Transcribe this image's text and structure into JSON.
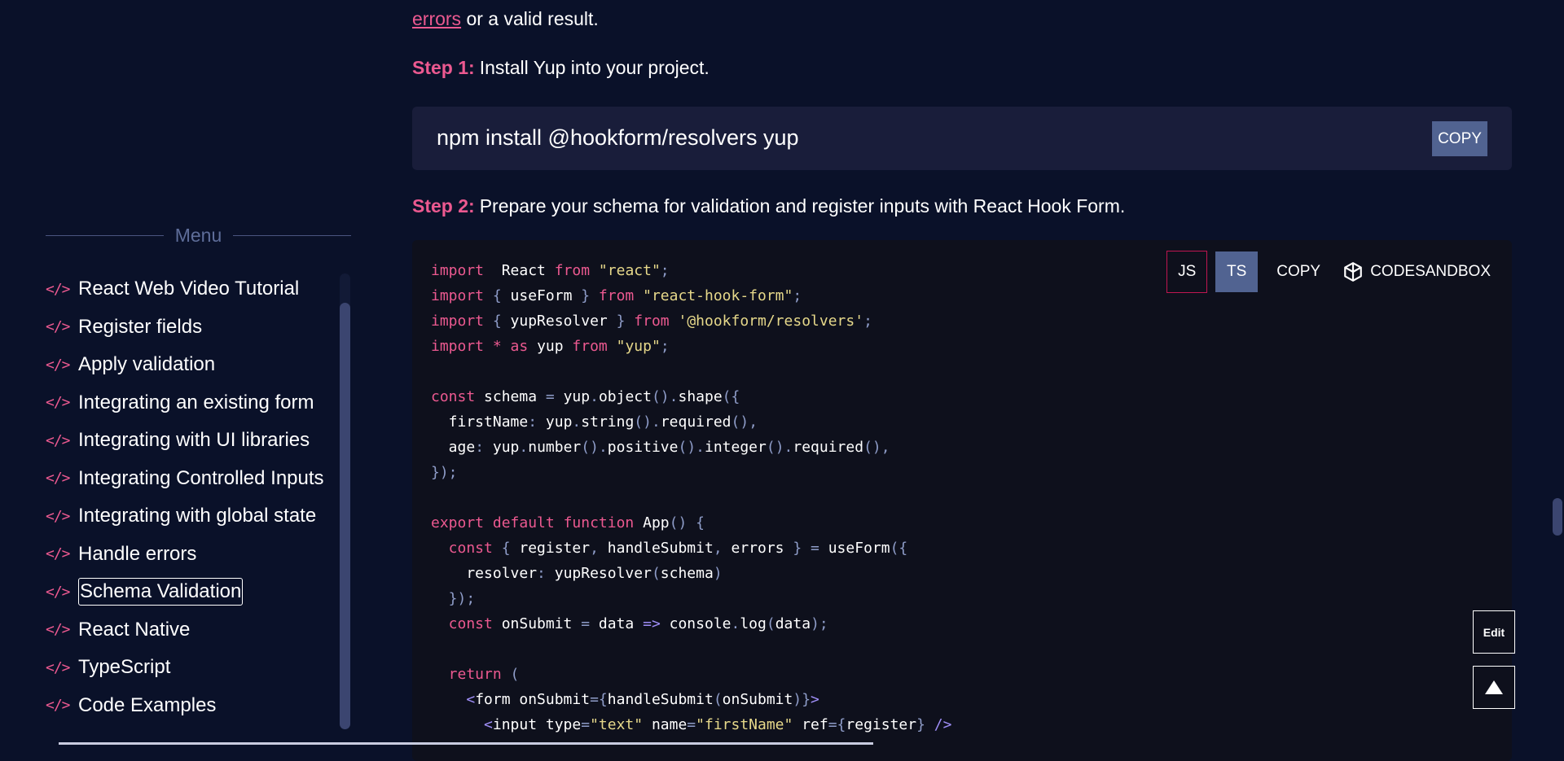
{
  "intro": {
    "link_text": "errors",
    "text_after": " or a valid result."
  },
  "step1": {
    "label": "Step 1:",
    "text": "Install Yup into your project."
  },
  "install": {
    "command": "npm install @hookform/resolvers yup",
    "copy_label": "COPY"
  },
  "step2": {
    "label": "Step 2:",
    "text": "Prepare your schema for validation and register inputs with React Hook Form."
  },
  "code_tools": {
    "js_label": "JS",
    "ts_label": "TS",
    "copy_label": "COPY",
    "sandbox_label": "CODESANDBOX",
    "sandbox_icon": "cube-icon"
  },
  "sidebar": {
    "menu_title": "Menu",
    "item_icon": "</>",
    "items": [
      {
        "label": "React Web Video Tutorial"
      },
      {
        "label": "Register fields"
      },
      {
        "label": "Apply validation"
      },
      {
        "label": "Integrating an existing form"
      },
      {
        "label": "Integrating with UI libraries"
      },
      {
        "label": "Integrating Controlled Inputs"
      },
      {
        "label": "Integrating with global state"
      },
      {
        "label": "Handle errors"
      },
      {
        "label": "Schema Validation"
      },
      {
        "label": "React Native"
      },
      {
        "label": "TypeScript"
      },
      {
        "label": "Code Examples"
      }
    ],
    "active_index": 8
  },
  "code_lines": [
    [
      [
        "kw",
        "import"
      ],
      [
        "",
        "  React "
      ],
      [
        "kw",
        "from"
      ],
      [
        "",
        ""
      ],
      [
        "str",
        " \"react\""
      ],
      [
        "pu",
        ";"
      ]
    ],
    [
      [
        "kw",
        "import"
      ],
      [
        "pu",
        " { "
      ],
      [
        "",
        "useForm"
      ],
      [
        "pu",
        " } "
      ],
      [
        "kw",
        "from"
      ],
      [
        "str",
        " \"react-hook-form\""
      ],
      [
        "pu",
        ";"
      ]
    ],
    [
      [
        "kw",
        "import"
      ],
      [
        "pu",
        " { "
      ],
      [
        "",
        "yupResolver"
      ],
      [
        "pu",
        " } "
      ],
      [
        "kw",
        "from"
      ],
      [
        "str",
        " '@hookform/resolvers'"
      ],
      [
        "pu",
        ";"
      ]
    ],
    [
      [
        "kw",
        "import"
      ],
      [
        "kw",
        " * "
      ],
      [
        "kw",
        "as"
      ],
      [
        "",
        " yup "
      ],
      [
        "kw",
        "from"
      ],
      [
        "str",
        " \"yup\""
      ],
      [
        "pu",
        ";"
      ]
    ],
    [],
    [
      [
        "kw",
        "const"
      ],
      [
        "",
        " schema "
      ],
      [
        "pu",
        "="
      ],
      [
        "",
        " yup"
      ],
      [
        "pu",
        "."
      ],
      [
        "",
        "object"
      ],
      [
        "pu",
        "()."
      ],
      [
        "",
        "shape"
      ],
      [
        "pu",
        "({"
      ]
    ],
    [
      [
        "",
        "  firstName"
      ],
      [
        "pu",
        ":"
      ],
      [
        "",
        " yup"
      ],
      [
        "pu",
        "."
      ],
      [
        "",
        "string"
      ],
      [
        "pu",
        "()."
      ],
      [
        "",
        "required"
      ],
      [
        "pu",
        "(),"
      ]
    ],
    [
      [
        "",
        "  age"
      ],
      [
        "pu",
        ":"
      ],
      [
        "",
        " yup"
      ],
      [
        "pu",
        "."
      ],
      [
        "",
        "number"
      ],
      [
        "pu",
        "()."
      ],
      [
        "",
        "positive"
      ],
      [
        "pu",
        "()."
      ],
      [
        "",
        "integer"
      ],
      [
        "pu",
        "()."
      ],
      [
        "",
        "required"
      ],
      [
        "pu",
        "(),"
      ]
    ],
    [
      [
        "pu",
        "});"
      ]
    ],
    [],
    [
      [
        "kw",
        "export"
      ],
      [
        "kw",
        " default"
      ],
      [
        "kw",
        " function"
      ],
      [
        "",
        " App"
      ],
      [
        "pu",
        "() {"
      ]
    ],
    [
      [
        "kw",
        "  const"
      ],
      [
        "pu",
        " { "
      ],
      [
        "",
        "register"
      ],
      [
        "pu",
        ", "
      ],
      [
        "",
        "handleSubmit"
      ],
      [
        "pu",
        ", "
      ],
      [
        "",
        "errors"
      ],
      [
        "pu",
        " } = "
      ],
      [
        "",
        "useForm"
      ],
      [
        "pu",
        "({"
      ]
    ],
    [
      [
        "",
        "    resolver"
      ],
      [
        "pu",
        ":"
      ],
      [
        "",
        " yupResolver"
      ],
      [
        "pu",
        "("
      ],
      [
        "",
        "schema"
      ],
      [
        "pu",
        ")"
      ]
    ],
    [
      [
        "pu",
        "  });"
      ]
    ],
    [
      [
        "kw",
        "  const"
      ],
      [
        "",
        " onSubmit "
      ],
      [
        "pu",
        "="
      ],
      [
        "",
        " data "
      ],
      [
        "tg",
        "=>"
      ],
      [
        "",
        " console"
      ],
      [
        "pu",
        "."
      ],
      [
        "",
        "log"
      ],
      [
        "pu",
        "("
      ],
      [
        "",
        "data"
      ],
      [
        "pu",
        ");"
      ]
    ],
    [],
    [
      [
        "kw",
        "  return"
      ],
      [
        "pu",
        " ("
      ]
    ],
    [
      [
        "tg",
        "    <"
      ],
      [
        "",
        "form onSubmit"
      ],
      [
        "pu",
        "={"
      ],
      [
        "",
        "handleSubmit"
      ],
      [
        "pu",
        "("
      ],
      [
        "",
        "onSubmit"
      ],
      [
        "pu",
        ")}"
      ],
      [
        "tg",
        ">"
      ]
    ],
    [
      [
        "tg",
        "      <"
      ],
      [
        "",
        "input type"
      ],
      [
        "pu",
        "="
      ],
      [
        "str",
        "\"text\""
      ],
      [
        "",
        " name"
      ],
      [
        "pu",
        "="
      ],
      [
        "str",
        "\"firstName\""
      ],
      [
        "",
        " ref"
      ],
      [
        "pu",
        "={"
      ],
      [
        "",
        "register"
      ],
      [
        "pu",
        "} "
      ],
      [
        "tg",
        "/>"
      ]
    ]
  ],
  "floating": {
    "edit_label": "Edit",
    "top_icon": "arrow-up-icon"
  }
}
